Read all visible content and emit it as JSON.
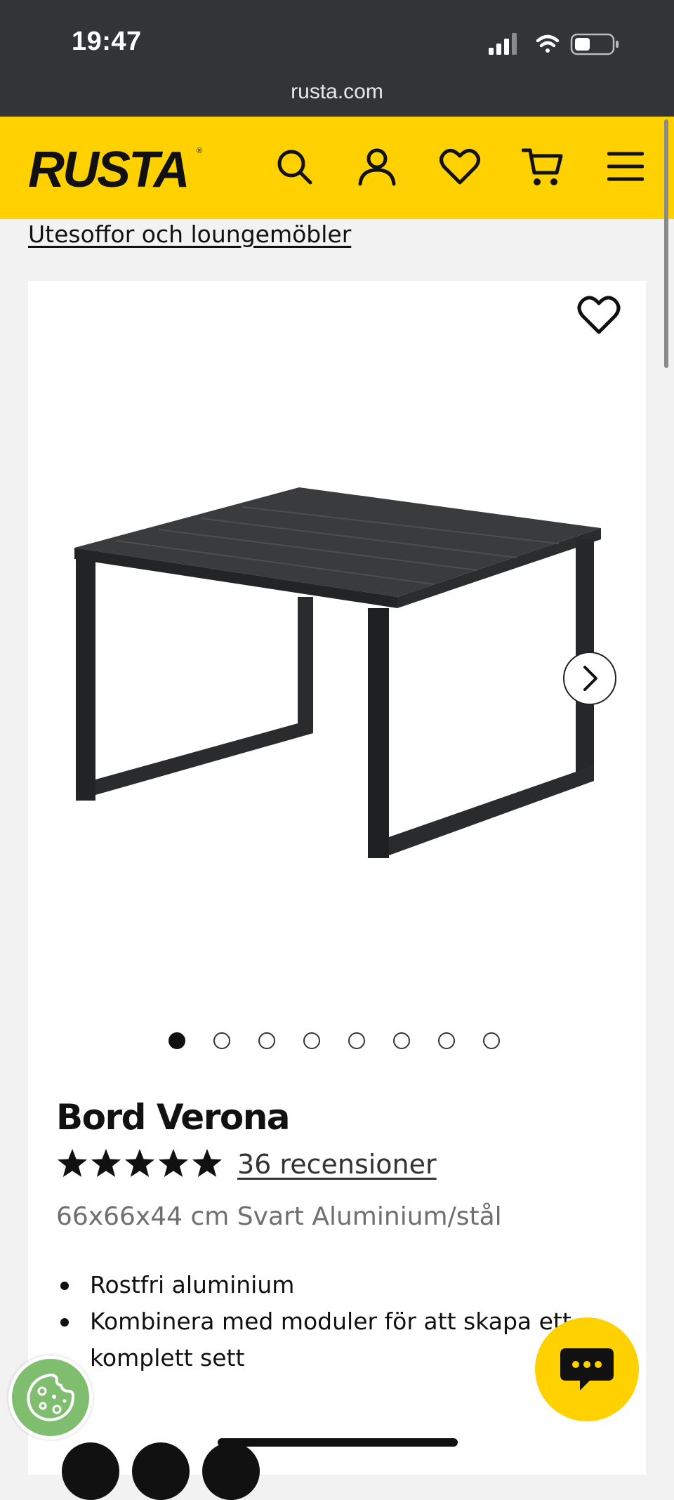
{
  "status_bar": {
    "time": "19:47",
    "battery_level": 0.35
  },
  "browser": {
    "url": "rusta.com"
  },
  "header": {
    "logo_text": "RUSTA",
    "icons": [
      "search-icon",
      "account-icon",
      "wishlist-icon",
      "cart-icon",
      "menu-icon"
    ],
    "background_color": "#ffd100"
  },
  "breadcrumb": {
    "label": "Utesoffor och loungemöbler"
  },
  "product": {
    "title": "Bord Verona",
    "rating": 5,
    "rating_max": 5,
    "reviews_label": "36 recensioner",
    "subtitle": "66x66x44 cm Svart Aluminium/stål",
    "features": [
      "Rostfri aluminium",
      "Kombinera med moduler för att skapa ett komplett sett"
    ],
    "gallery": {
      "total_images": 8,
      "active_index": 0
    }
  },
  "colors": {
    "accent": "#ffd100",
    "cookie_button": "#7fbe6f",
    "status_bar": "#333436"
  }
}
